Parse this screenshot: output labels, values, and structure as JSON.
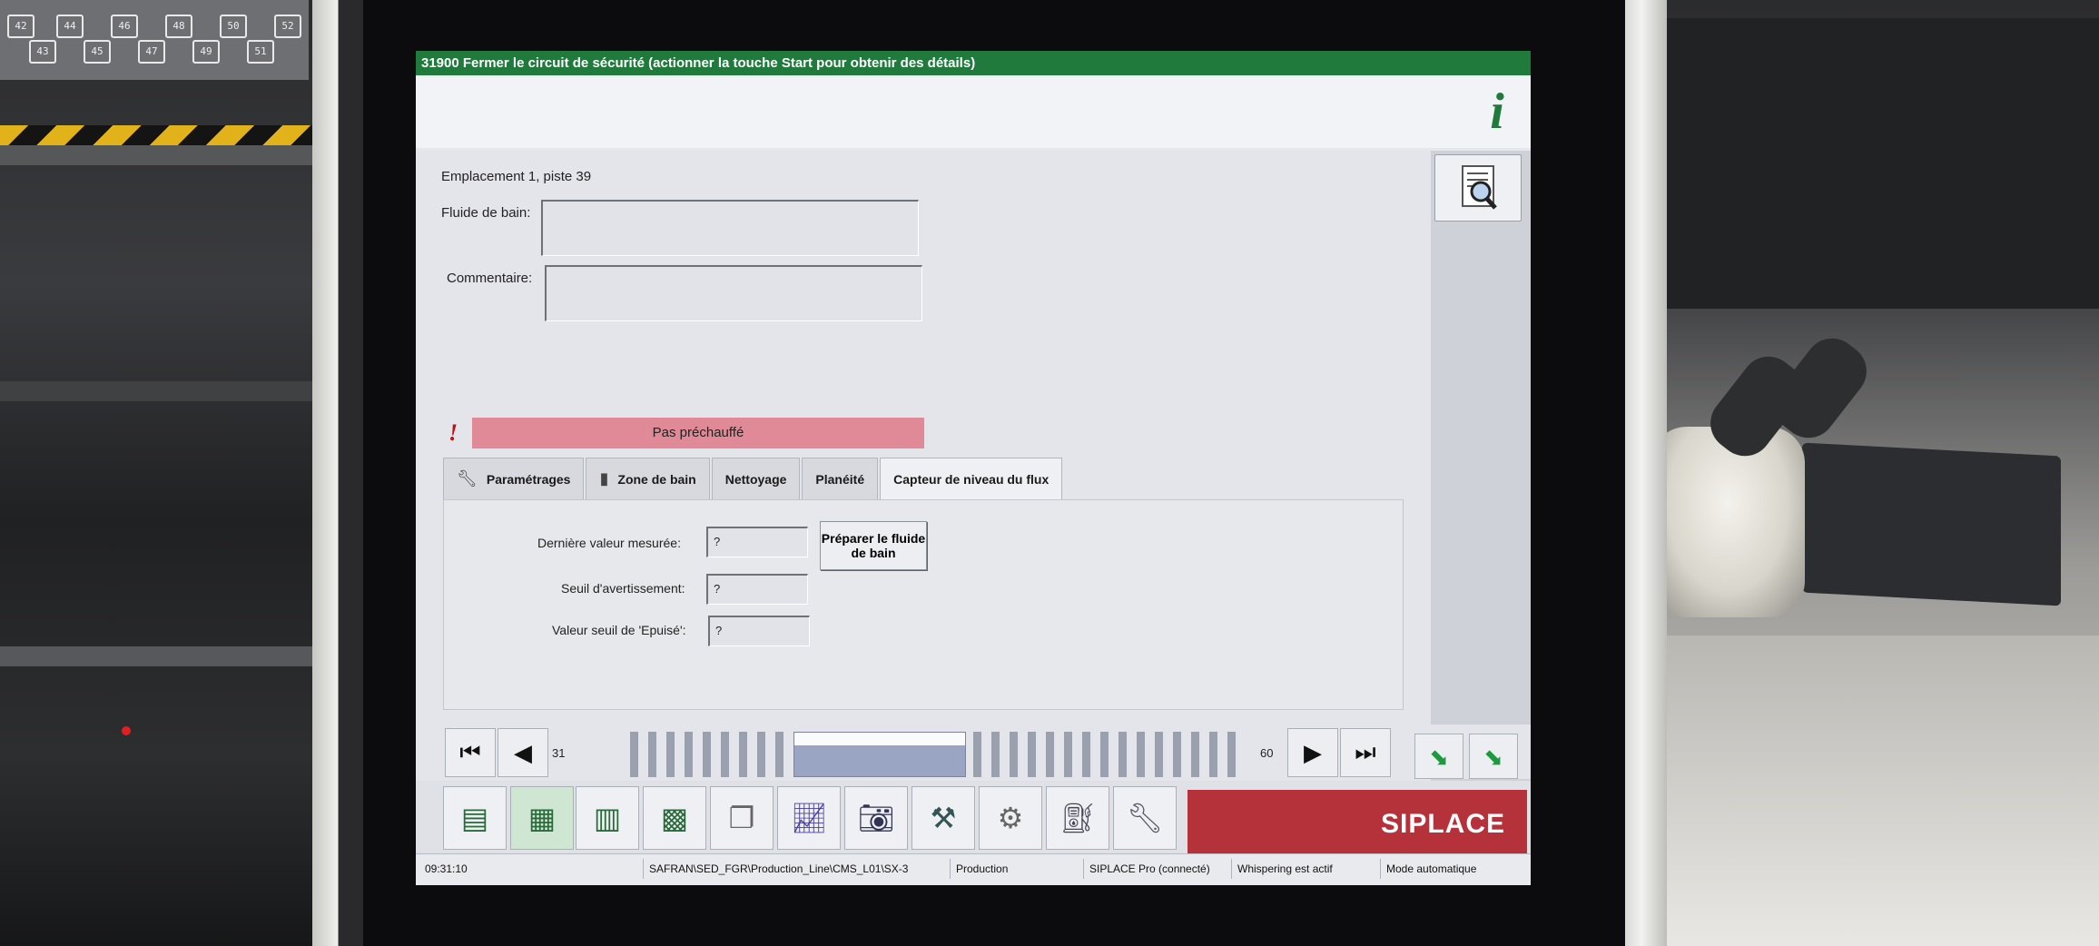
{
  "keyboard_keys": [
    "42",
    "44",
    "45",
    "46",
    "47",
    "48",
    "49",
    "50",
    "51",
    "52",
    "43"
  ],
  "screen": {
    "alarm_title": "31900 Fermer le circuit de sécurité (actionner la touche Start pour obtenir des détails)",
    "info_icon": "info-icon",
    "search_icon": "search-list-icon",
    "location": "Emplacement 1, piste 39",
    "fields": {
      "bath_fluid_label": "Fluide de bain:",
      "comment_label": "Commentaire:"
    },
    "alert": {
      "icon": "!",
      "text": "Pas préchauffé",
      "color": "#df8a96"
    },
    "tabs": [
      {
        "label": "Paramétrages",
        "icon": "wrench-icon"
      },
      {
        "label": "Zone de bain",
        "icon": "book-icon"
      },
      {
        "label": "Nettoyage"
      },
      {
        "label": "Planéité"
      },
      {
        "label": "Capteur de niveau du flux",
        "active": true
      }
    ],
    "flux_sensor": {
      "last_value_label": "Dernière valeur mesurée:",
      "last_value": "?",
      "warning_label": "Seuil d'avertissement:",
      "warning_value": "?",
      "empty_label": "Valeur seuil de 'Epuisé':",
      "empty_value": "?",
      "prepare_button": "Préparer le fluide de bain"
    },
    "navigation": {
      "first_icon": "skip-first-icon",
      "prev_icon": "prev-icon",
      "start_page": "31",
      "end_page": "60",
      "next_icon": "next-icon",
      "last_icon": "skip-last-icon"
    },
    "toolbar_icons": [
      "money-stack-icon",
      "grid-icon",
      "bar-levels-icon",
      "board-icon",
      "clipboard-icon",
      "chart-icon",
      "camera-icon",
      "tools-icon",
      "gear-hand-icon",
      "oil-can-icon",
      "wrench-person-icon"
    ],
    "brand": "SIPLACE",
    "brand_color": "#b5323a",
    "status": {
      "time": "09:31:10",
      "path": "SAFRAN\\SED_FGR\\Production_Line\\CMS_L01\\SX-3",
      "mode": "Production",
      "connection": "SIPLACE Pro (connecté)",
      "whisper": "Whispering est actif",
      "auto": "Mode automatique"
    },
    "accent_green": "#1f7a3c"
  }
}
